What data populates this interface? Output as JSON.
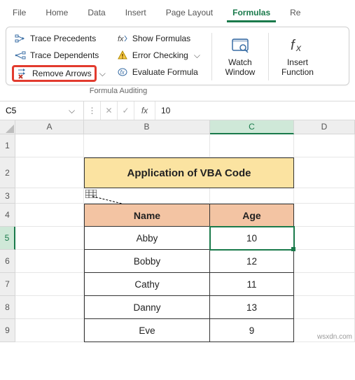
{
  "tabs": {
    "file": "File",
    "home": "Home",
    "data": "Data",
    "insert": "Insert",
    "page_layout": "Page Layout",
    "formulas": "Formulas",
    "review_partial": "Re"
  },
  "ribbon": {
    "trace_precedents": "Trace Precedents",
    "trace_dependents": "Trace Dependents",
    "remove_arrows": "Remove Arrows",
    "show_formulas": "Show Formulas",
    "error_checking": "Error Checking",
    "evaluate_formula": "Evaluate Formula",
    "watch_window": "Watch Window",
    "insert_function": "Insert Function",
    "group_caption": "Formula Auditing"
  },
  "formula_bar": {
    "name_box": "C5",
    "fx_label": "fx",
    "value": "10"
  },
  "columns": {
    "a": "A",
    "b": "B",
    "c": "C",
    "d": "D"
  },
  "rows": [
    "1",
    "2",
    "3",
    "4",
    "5",
    "6",
    "7",
    "8",
    "9"
  ],
  "sheet": {
    "title": "Application of VBA Code",
    "header_name": "Name",
    "header_age": "Age",
    "data": [
      {
        "name": "Abby",
        "age": "10"
      },
      {
        "name": "Bobby",
        "age": "12"
      },
      {
        "name": "Cathy",
        "age": "11"
      },
      {
        "name": "Danny",
        "age": "13"
      },
      {
        "name": "Eve",
        "age": "9"
      }
    ]
  },
  "chart_data": {
    "type": "table",
    "title": "Application of VBA Code",
    "columns": [
      "Name",
      "Age"
    ],
    "rows": [
      [
        "Abby",
        10
      ],
      [
        "Bobby",
        12
      ],
      [
        "Cathy",
        11
      ],
      [
        "Danny",
        13
      ],
      [
        "Eve",
        9
      ]
    ]
  },
  "watermark": "wsxdn.com"
}
